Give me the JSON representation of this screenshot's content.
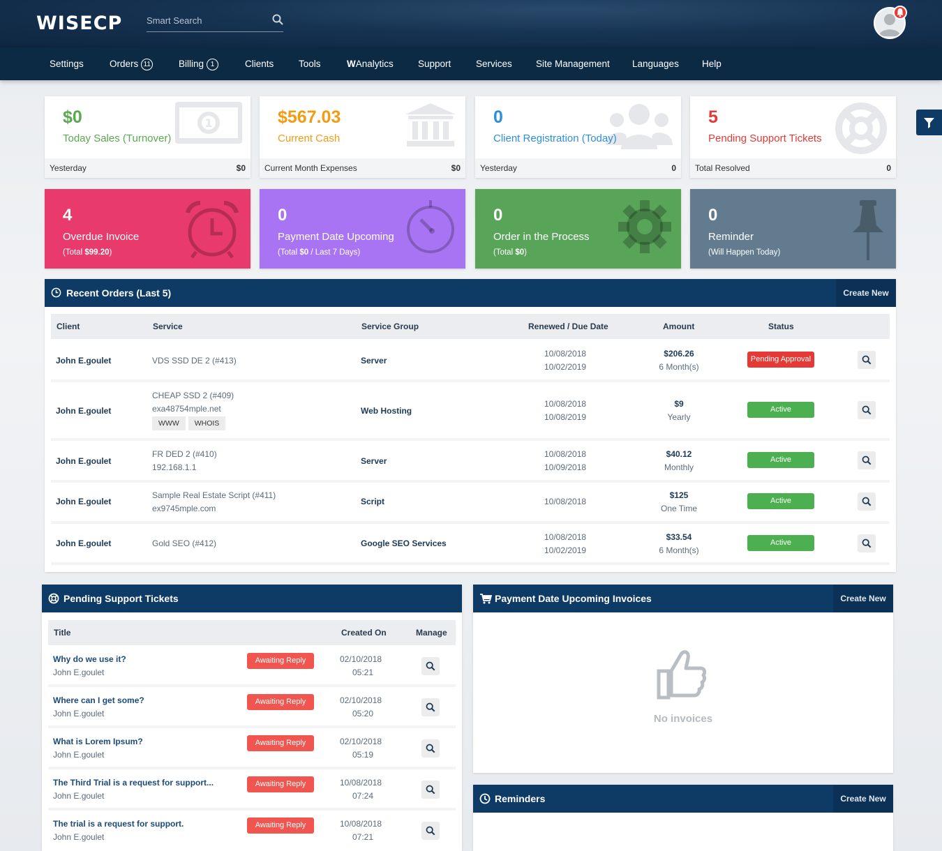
{
  "header": {
    "logo": "WISECP",
    "search_placeholder": "Smart Search"
  },
  "nav": {
    "items": [
      {
        "label": "Settings"
      },
      {
        "label": "Orders",
        "count": "11"
      },
      {
        "label": "Billing",
        "count": "1"
      },
      {
        "label": "Clients"
      },
      {
        "label": "Tools"
      },
      {
        "label": "WAnalytics",
        "prefix": "W",
        "rest": "Analytics"
      },
      {
        "label": "Support"
      },
      {
        "label": "Services"
      },
      {
        "label": "Site Management"
      },
      {
        "label": "Languages"
      },
      {
        "label": "Help"
      }
    ]
  },
  "stats": [
    {
      "value": "$0",
      "label": "Today Sales (Turnover)",
      "foot_label": "Yesterday",
      "foot_value": "$0",
      "color": "#5aa84f",
      "icon": "money-icon"
    },
    {
      "value": "$567.03",
      "label": "Current Cash",
      "foot_label": "Current Month Expenses",
      "foot_value": "$0",
      "color": "#f39c12",
      "icon": "bank-icon"
    },
    {
      "value": "0",
      "label": "Client Registration (Today)",
      "foot_label": "Yesterday",
      "foot_value": "0",
      "color": "#2d8fd8",
      "icon": "users-icon"
    },
    {
      "value": "5",
      "label": "Pending Support Tickets",
      "foot_label": "Total Resolved",
      "foot_value": "0",
      "color": "#e53935",
      "icon": "lifebuoy-icon"
    }
  ],
  "tiles": [
    {
      "value": "4",
      "label": "Overdue Invoice",
      "sub_pre": "(Total ",
      "sub_bold": "$99.20",
      "sub_post": ")",
      "color": "#e83a6b",
      "icon": "alarm-clock-icon"
    },
    {
      "value": "0",
      "label": "Payment Date Upcoming",
      "sub_pre": "(Total ",
      "sub_bold": "$0",
      "sub_post": " / Last 7 Days)",
      "color": "#a974f3",
      "icon": "timer-icon"
    },
    {
      "value": "0",
      "label": "Order in the Process",
      "sub_pre": "(Total ",
      "sub_bold": "$0",
      "sub_post": ")",
      "color": "#58a55a",
      "icon": "gear-icon"
    },
    {
      "value": "0",
      "label": "Reminder",
      "sub_pre": "(Will Happen Today)",
      "sub_bold": "",
      "sub_post": "",
      "color": "#627b8e",
      "icon": "pushpin-icon"
    }
  ],
  "orders": {
    "title": "Recent Orders (Last 5)",
    "create_label": "Create New",
    "columns": [
      "Client",
      "Service",
      "Service Group",
      "Renewed / Due Date",
      "Amount",
      "Status"
    ],
    "rows": [
      {
        "client": "John E.goulet",
        "service": "VDS SSD DE 2 (#413)",
        "service2": "",
        "chips": [],
        "group": "Server",
        "date1": "10/08/2018",
        "date2": "10/02/2019",
        "amount": "$206.26",
        "period": "6 Month(s)",
        "status": "Pending Approval"
      },
      {
        "client": "John E.goulet",
        "service": "CHEAP SSD 2 (#409)",
        "service2": "exa48754mple.net",
        "chips": [
          "WWW",
          "WHOIS"
        ],
        "group": "Web Hosting",
        "date1": "10/08/2018",
        "date2": "10/08/2019",
        "amount": "$9",
        "period": "Yearly",
        "status": "Active"
      },
      {
        "client": "John E.goulet",
        "service": "FR DED 2 (#410)",
        "service2": "192.168.1.1",
        "chips": [],
        "group": "Server",
        "date1": "10/08/2018",
        "date2": "10/09/2018",
        "amount": "$40.12",
        "period": "Monthly",
        "status": "Active"
      },
      {
        "client": "John E.goulet",
        "service": "Sample Real Estate Script (#411)",
        "service2": "ex9745mple.com",
        "chips": [],
        "group": "Script",
        "date1": "10/08/2018",
        "date2": "",
        "amount": "$125",
        "period": "One Time",
        "status": "Active"
      },
      {
        "client": "John E.goulet",
        "service": "Gold SEO (#412)",
        "service2": "",
        "chips": [],
        "group": "Google SEO Services",
        "date1": "10/08/2018",
        "date2": "10/02/2019",
        "amount": "$33.54",
        "period": "6 Month(s)",
        "status": "Active"
      }
    ]
  },
  "tickets": {
    "title": "Pending Support Tickets",
    "columns": [
      "Title",
      "Created On",
      "Manage"
    ],
    "rows": [
      {
        "title": "Why do we use it?",
        "client": "John E.goulet",
        "status": "Awaiting Reply",
        "date": "02/10/2018",
        "time": "05:21"
      },
      {
        "title": "Where can I get some?",
        "client": "John E.goulet",
        "status": "Awaiting Reply",
        "date": "02/10/2018",
        "time": "05:20"
      },
      {
        "title": "What is Lorem Ipsum?",
        "client": "John E.goulet",
        "status": "Awaiting Reply",
        "date": "02/10/2018",
        "time": "05:19"
      },
      {
        "title": "The Third Trial is a request for support...",
        "client": "John E.goulet",
        "status": "Awaiting Reply",
        "date": "10/08/2018",
        "time": "07:24"
      },
      {
        "title": "The trial is a request for support.",
        "client": "John E.goulet",
        "status": "Awaiting Reply",
        "date": "10/08/2018",
        "time": "07:21"
      }
    ]
  },
  "invoices": {
    "title": "Payment Date Upcoming Invoices",
    "create_label": "Create New",
    "empty_text": "No invoices"
  },
  "reminders": {
    "title": "Reminders",
    "create_label": "Create New"
  }
}
